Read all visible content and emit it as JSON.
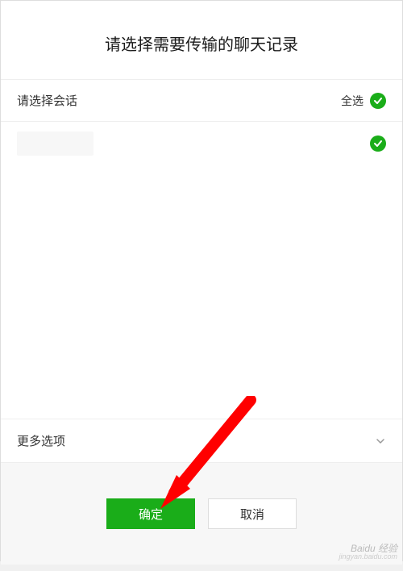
{
  "header": {
    "title": "请选择需要传输的聊天记录"
  },
  "conversation_section": {
    "title": "请选择会话",
    "select_all_label": "全选"
  },
  "more_options": {
    "label": "更多选项"
  },
  "footer": {
    "confirm_label": "确定",
    "cancel_label": "取消"
  },
  "watermark": {
    "main": "Baidu 经验",
    "sub": "jingyan.baidu.com"
  }
}
